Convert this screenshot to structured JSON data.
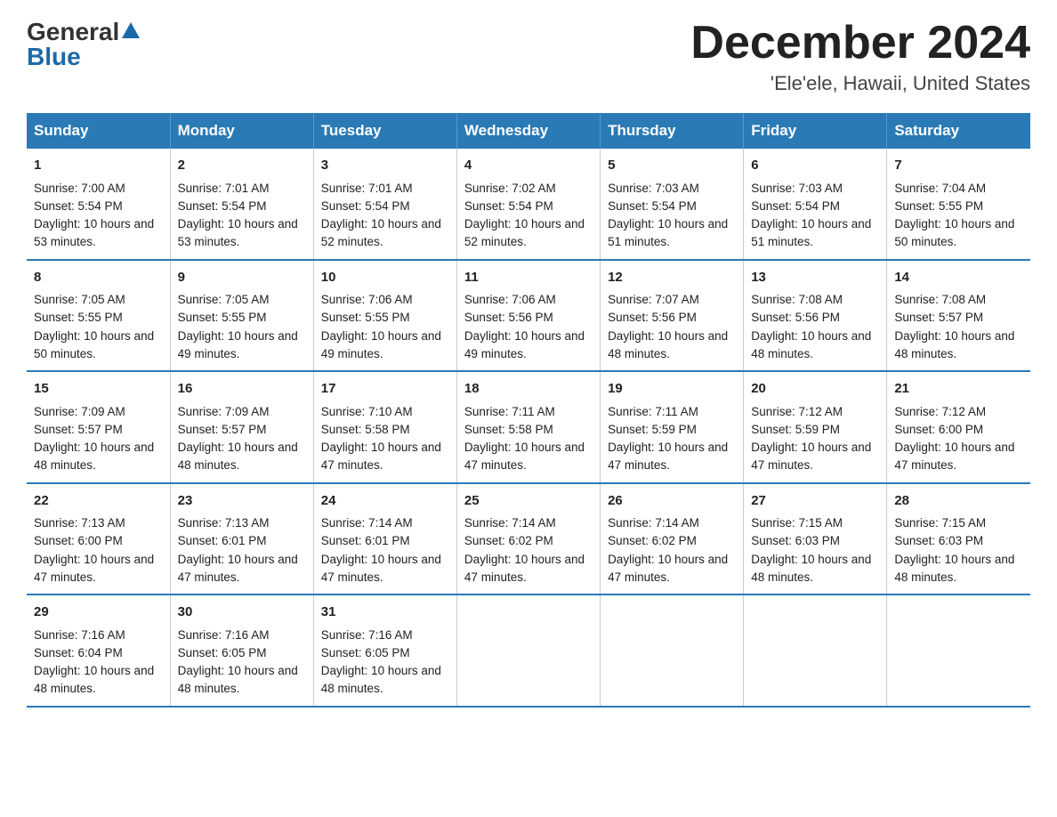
{
  "logo": {
    "general": "General",
    "blue": "Blue",
    "triangle": "▲"
  },
  "title": "December 2024",
  "subtitle": "'Ele'ele, Hawaii, United States",
  "headers": [
    "Sunday",
    "Monday",
    "Tuesday",
    "Wednesday",
    "Thursday",
    "Friday",
    "Saturday"
  ],
  "weeks": [
    [
      {
        "day": "1",
        "sunrise": "7:00 AM",
        "sunset": "5:54 PM",
        "daylight": "10 hours and 53 minutes."
      },
      {
        "day": "2",
        "sunrise": "7:01 AM",
        "sunset": "5:54 PM",
        "daylight": "10 hours and 53 minutes."
      },
      {
        "day": "3",
        "sunrise": "7:01 AM",
        "sunset": "5:54 PM",
        "daylight": "10 hours and 52 minutes."
      },
      {
        "day": "4",
        "sunrise": "7:02 AM",
        "sunset": "5:54 PM",
        "daylight": "10 hours and 52 minutes."
      },
      {
        "day": "5",
        "sunrise": "7:03 AM",
        "sunset": "5:54 PM",
        "daylight": "10 hours and 51 minutes."
      },
      {
        "day": "6",
        "sunrise": "7:03 AM",
        "sunset": "5:54 PM",
        "daylight": "10 hours and 51 minutes."
      },
      {
        "day": "7",
        "sunrise": "7:04 AM",
        "sunset": "5:55 PM",
        "daylight": "10 hours and 50 minutes."
      }
    ],
    [
      {
        "day": "8",
        "sunrise": "7:05 AM",
        "sunset": "5:55 PM",
        "daylight": "10 hours and 50 minutes."
      },
      {
        "day": "9",
        "sunrise": "7:05 AM",
        "sunset": "5:55 PM",
        "daylight": "10 hours and 49 minutes."
      },
      {
        "day": "10",
        "sunrise": "7:06 AM",
        "sunset": "5:55 PM",
        "daylight": "10 hours and 49 minutes."
      },
      {
        "day": "11",
        "sunrise": "7:06 AM",
        "sunset": "5:56 PM",
        "daylight": "10 hours and 49 minutes."
      },
      {
        "day": "12",
        "sunrise": "7:07 AM",
        "sunset": "5:56 PM",
        "daylight": "10 hours and 48 minutes."
      },
      {
        "day": "13",
        "sunrise": "7:08 AM",
        "sunset": "5:56 PM",
        "daylight": "10 hours and 48 minutes."
      },
      {
        "day": "14",
        "sunrise": "7:08 AM",
        "sunset": "5:57 PM",
        "daylight": "10 hours and 48 minutes."
      }
    ],
    [
      {
        "day": "15",
        "sunrise": "7:09 AM",
        "sunset": "5:57 PM",
        "daylight": "10 hours and 48 minutes."
      },
      {
        "day": "16",
        "sunrise": "7:09 AM",
        "sunset": "5:57 PM",
        "daylight": "10 hours and 48 minutes."
      },
      {
        "day": "17",
        "sunrise": "7:10 AM",
        "sunset": "5:58 PM",
        "daylight": "10 hours and 47 minutes."
      },
      {
        "day": "18",
        "sunrise": "7:11 AM",
        "sunset": "5:58 PM",
        "daylight": "10 hours and 47 minutes."
      },
      {
        "day": "19",
        "sunrise": "7:11 AM",
        "sunset": "5:59 PM",
        "daylight": "10 hours and 47 minutes."
      },
      {
        "day": "20",
        "sunrise": "7:12 AM",
        "sunset": "5:59 PM",
        "daylight": "10 hours and 47 minutes."
      },
      {
        "day": "21",
        "sunrise": "7:12 AM",
        "sunset": "6:00 PM",
        "daylight": "10 hours and 47 minutes."
      }
    ],
    [
      {
        "day": "22",
        "sunrise": "7:13 AM",
        "sunset": "6:00 PM",
        "daylight": "10 hours and 47 minutes."
      },
      {
        "day": "23",
        "sunrise": "7:13 AM",
        "sunset": "6:01 PM",
        "daylight": "10 hours and 47 minutes."
      },
      {
        "day": "24",
        "sunrise": "7:14 AM",
        "sunset": "6:01 PM",
        "daylight": "10 hours and 47 minutes."
      },
      {
        "day": "25",
        "sunrise": "7:14 AM",
        "sunset": "6:02 PM",
        "daylight": "10 hours and 47 minutes."
      },
      {
        "day": "26",
        "sunrise": "7:14 AM",
        "sunset": "6:02 PM",
        "daylight": "10 hours and 47 minutes."
      },
      {
        "day": "27",
        "sunrise": "7:15 AM",
        "sunset": "6:03 PM",
        "daylight": "10 hours and 48 minutes."
      },
      {
        "day": "28",
        "sunrise": "7:15 AM",
        "sunset": "6:03 PM",
        "daylight": "10 hours and 48 minutes."
      }
    ],
    [
      {
        "day": "29",
        "sunrise": "7:16 AM",
        "sunset": "6:04 PM",
        "daylight": "10 hours and 48 minutes."
      },
      {
        "day": "30",
        "sunrise": "7:16 AM",
        "sunset": "6:05 PM",
        "daylight": "10 hours and 48 minutes."
      },
      {
        "day": "31",
        "sunrise": "7:16 AM",
        "sunset": "6:05 PM",
        "daylight": "10 hours and 48 minutes."
      },
      null,
      null,
      null,
      null
    ]
  ],
  "labels": {
    "sunrise": "Sunrise:",
    "sunset": "Sunset:",
    "daylight": "Daylight:"
  }
}
